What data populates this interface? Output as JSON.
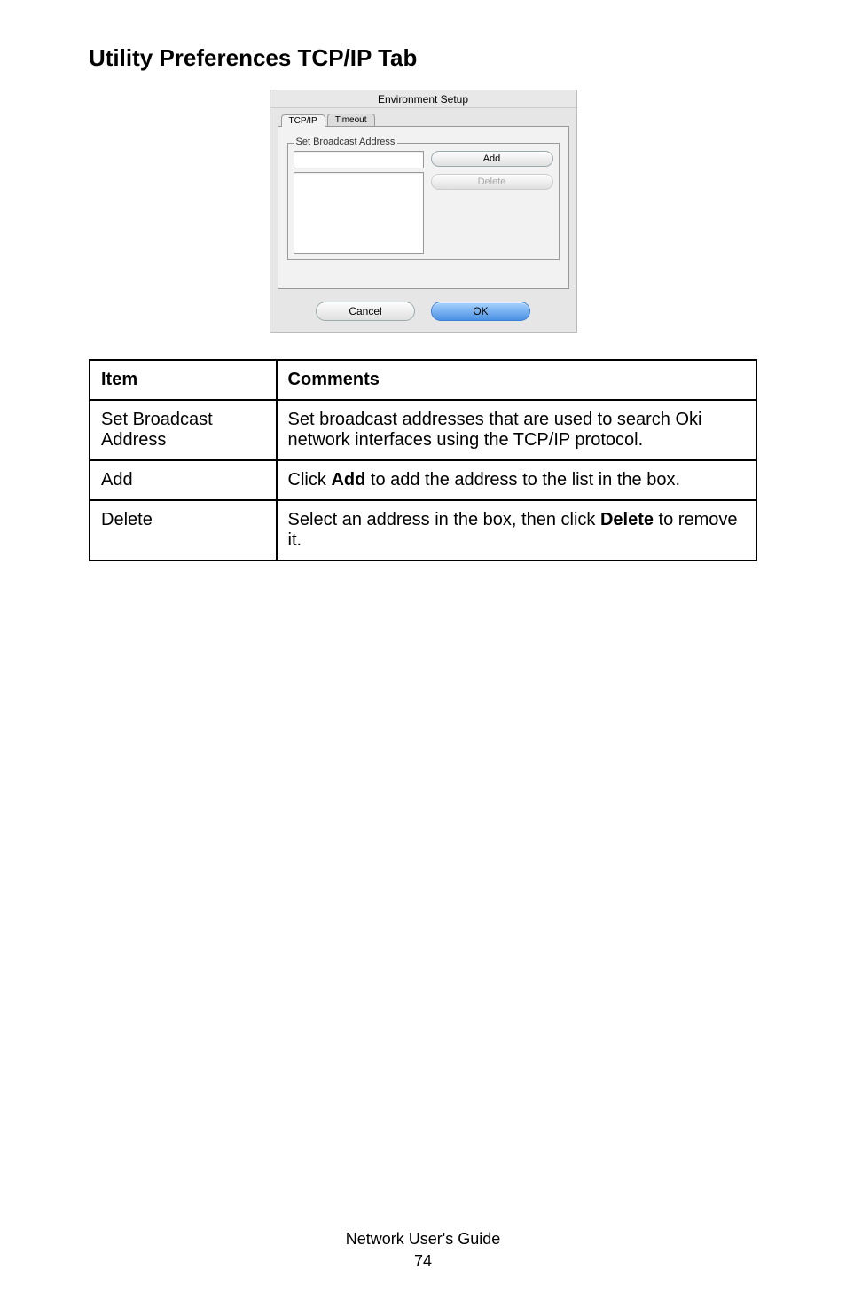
{
  "heading": "Utility Preferences TCP/IP Tab",
  "dialog": {
    "title": "Environment Setup",
    "tabs": {
      "tcpip": "TCP/IP",
      "timeout": "Timeout"
    },
    "fieldset_legend": "Set Broadcast Address",
    "buttons": {
      "add": "Add",
      "delete": "Delete",
      "cancel": "Cancel",
      "ok": "OK"
    }
  },
  "table": {
    "headers": {
      "item": "Item",
      "comments": "Comments"
    },
    "rows": [
      {
        "item": "Set Broadcast Address",
        "comment": "Set broadcast addresses that are used to search Oki network interfaces using the TCP/IP protocol."
      },
      {
        "item": "Add",
        "comment_pre": "Click ",
        "comment_bold": "Add",
        "comment_post": " to add the address to the list in the box."
      },
      {
        "item": "Delete",
        "comment_pre": "Select an address in the box, then click ",
        "comment_bold": "Delete",
        "comment_post": " to remove it."
      }
    ]
  },
  "footer": {
    "line1": "Network User's Guide",
    "line2": "74"
  }
}
